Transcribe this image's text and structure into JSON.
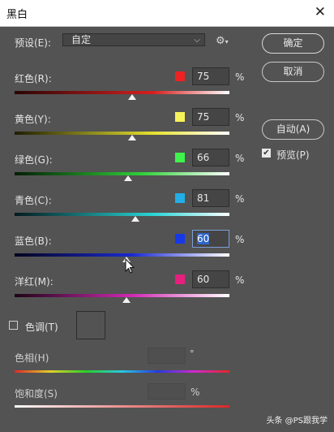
{
  "window": {
    "title": "黑白",
    "close_glyph": "✕"
  },
  "preset": {
    "label": "预设(E):",
    "value": "自定",
    "chevron": "⌵",
    "gear_glyph": "⚙",
    "gear_dd": "▾"
  },
  "buttons": {
    "ok": "确定",
    "cancel": "取消",
    "auto": "自动(A)"
  },
  "preview": {
    "label": "预览(P)",
    "checked": true,
    "check_glyph": "✔"
  },
  "sliders": [
    {
      "label": "红色(R):",
      "value": "75",
      "unit": "%",
      "swatch": "#ee2222"
    },
    {
      "label": "黄色(Y):",
      "value": "75",
      "unit": "%",
      "swatch": "#f6f25a"
    },
    {
      "label": "绿色(G):",
      "value": "66",
      "unit": "%",
      "swatch": "#3ff24c"
    },
    {
      "label": "青色(C):",
      "value": "81",
      "unit": "%",
      "swatch": "#22aee6"
    },
    {
      "label": "蓝色(B):",
      "value": "60",
      "unit": "%",
      "swatch": "#1638e6"
    },
    {
      "label": "洋红(M):",
      "value": "60",
      "unit": "%",
      "swatch": "#e6207e"
    }
  ],
  "tint": {
    "label": "色调(T)",
    "checked": false
  },
  "hue": {
    "label": "色相(H)",
    "unit": "°"
  },
  "saturation": {
    "label": "饱和度(S)",
    "unit": "%"
  },
  "watermark": "头条 @PS跟我学"
}
